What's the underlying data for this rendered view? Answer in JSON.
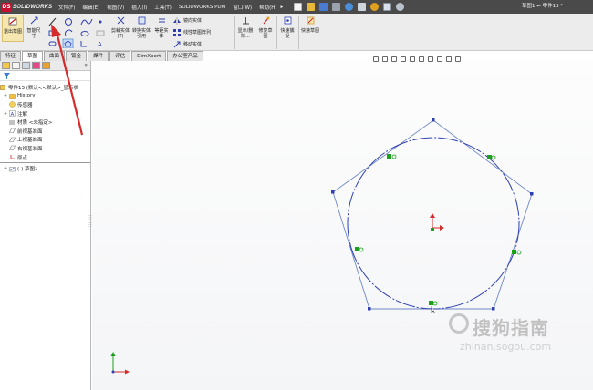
{
  "app": {
    "brand_prefix": "DS",
    "brand": "SOLIDWORKS",
    "menus": [
      "文件(F)",
      "编辑(E)",
      "视图(V)",
      "插入(I)",
      "工具(T)",
      "SOLIDWORKS PDM",
      "窗口(W)",
      "帮助(H)"
    ],
    "menu_overflow": "▸",
    "document_title": "草图1 ← 零件13 *"
  },
  "ribbon": {
    "exit_sketch": "退出草图",
    "smart_dimension": "智能尺寸",
    "trim_entities": "剪裁实体(T)",
    "convert_entities": "转换实体引用",
    "offset_entities": "等距实体",
    "mirror_entities": "镜向实体",
    "linear_pattern": "线性草图阵列",
    "move_entities": "移动实体",
    "display_delete": "显示/删除...",
    "repair_sketch": "修复草图",
    "quick_snaps": "快速捕捉",
    "rapid_sketch": "快速草图"
  },
  "tabs": [
    "特征",
    "草图",
    "曲面",
    "钣金",
    "焊件",
    "评估",
    "DimXpert",
    "办公室产品"
  ],
  "active_tab": 1,
  "tree": {
    "root": "零件13 (默认<<默认>_显示状",
    "items": [
      "History",
      "传感器",
      "注解",
      "材质 <未指定>",
      "前视基准面",
      "上视基准面",
      "右视基准面",
      "原点"
    ],
    "sketch": "(-) 草图1"
  },
  "colors": {
    "accent_red": "#d62b2b",
    "sketch_blue": "#2f3fb0",
    "relation_green": "#1aa01a",
    "menu_bar": "#4a4a4a"
  },
  "watermark": {
    "cn": "搜狗指南",
    "en": "zhinan.sogou.com"
  }
}
